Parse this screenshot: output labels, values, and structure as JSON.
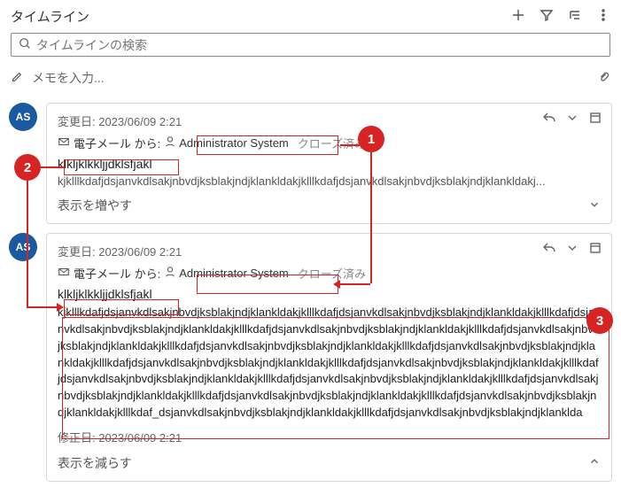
{
  "header": {
    "title": "タイムライン"
  },
  "search": {
    "placeholder": "タイムラインの検索"
  },
  "note": {
    "placeholder": "メモを入力..."
  },
  "avatar": "AS",
  "items": [
    {
      "meta": "変更日: 2023/06/09 2:21",
      "label_from": "電子メール から:",
      "from": "Administrator System",
      "status": "クローズ済み",
      "subject": "klkljklkkljjdklsfjakl",
      "body": "kjklllkdafjdsjanvkdlsakjnbvdjksblakjndjklankldakjklllkdafjdsjanvkdlsakjnbvdjksblakjndjklankldakj...",
      "expand": "表示を増やす"
    },
    {
      "meta": "変更日: 2023/06/09 2:21",
      "label_from": "電子メール から:",
      "from": "Administrator System",
      "status": "クローズ済み",
      "subject": "klkljklkkljjdklsfjakl",
      "body": "kjklllkdafjdsjanvkdlsakjnbvdjksblakjndjklankldakjklllkdafjdsjanvkdlsakjnbvdjksblakjndjklankldakjklllkdafjdsjanvkdlsakjnbvdjksblakjndjklankldakjklllkdafjdsjanvkdlsakjnbvdjksblakjndjklankldakjklllkdafjdsjanvkdlsakjnbvdjksblakjndjklankldakjklllkdafjdsjanvkdlsakjnbvdjksblakjndjklankldakjklllkdafjdsjanvkdlsakjnbvdjksblakjndjklankldakjklllkdafjdsjanvkdlsakjnbvdjksblakjndjklankldakjklllkdafjdsjanvkdlsakjnbvdjksblakjndjklankldakjklllkdafjdsjanvkdlsakjnbvdjksblakjndjklankldakjklllkdafjdsjanvkdlsakjnbvdjksblakjndjklankldakjklllkdafjdsjanvkdlsakjnbvdjksblakjndjklankldakjklllkdafjdsjanvkdlsakjnbvdjksblakjndjklankldakjklllkdafjdsjanvkdlsakjnbvdjksblakjndjklankldakjklllkdaf_dsjanvkdlsakjnbvdjksblakjndjklankldakjklllkdafjdsjanvkdlsakjnbvdjksblakjndjklanklda",
      "modified": "修正日: 2023/06/09 2:21",
      "collapse": "表示を減らす"
    }
  ],
  "tags": {
    "1": "1",
    "2": "2",
    "3": "3"
  }
}
